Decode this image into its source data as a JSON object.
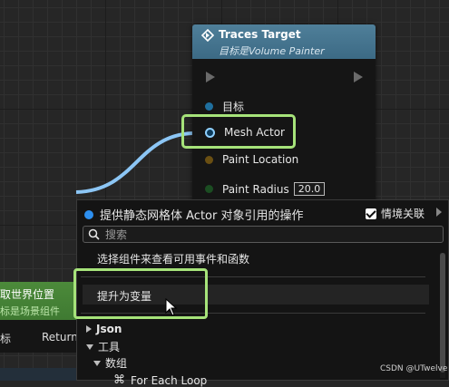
{
  "node": {
    "title": "Traces Target",
    "subtitle_prefix": "目标是",
    "subtitle_target": "Volume Painter",
    "header_color": "#4a7b96",
    "pins": [
      {
        "label": "目标",
        "color": "#1f6f9e"
      },
      {
        "label": "Mesh Actor",
        "color": "#35a7ff"
      },
      {
        "label": "Paint Location",
        "color": "#b58b2a"
      },
      {
        "label": "Paint Radius",
        "color": "#29a34a",
        "value": "20.0"
      }
    ]
  },
  "left_node": {
    "title": "取世界位置",
    "subtitle": "标是场景组件",
    "pin_target": "标",
    "pin_return": "Return"
  },
  "menu": {
    "title": "提供静态网格体 Actor 对象引用的操作",
    "context_label": "情境关联",
    "context_checked": true,
    "search_placeholder": "搜索",
    "hint": "选择组件来查看可用事件和函数",
    "promote_label": "提升为变量",
    "categories": [
      {
        "label": "Json",
        "expanded": false
      },
      {
        "label": "工具",
        "expanded": true
      },
      {
        "label": "数组",
        "expanded": true
      }
    ],
    "partial_item": "For Each Loop"
  },
  "accent_color": "#a6e37a",
  "watermark": "CSDN @UTwelve"
}
